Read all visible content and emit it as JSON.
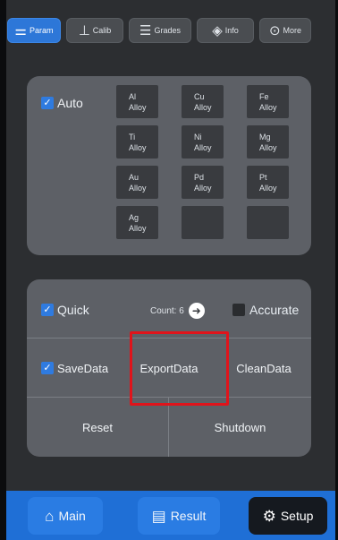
{
  "top_tabs": [
    {
      "label": "Param",
      "icon": "params-sliders-icon",
      "active": true
    },
    {
      "label": "Calib",
      "icon": "calibration-icon",
      "active": false
    },
    {
      "label": "Grades",
      "icon": "grades-database-icon",
      "active": false
    },
    {
      "label": "Info",
      "icon": "info-layers-icon",
      "active": false
    },
    {
      "label": "More",
      "icon": "more-dots-icon",
      "active": false
    }
  ],
  "alloy_panel": {
    "auto_label": "Auto",
    "auto_checked": true,
    "alloys": [
      {
        "element": "Al",
        "suffix": "Alloy"
      },
      {
        "element": "Cu",
        "suffix": "Alloy"
      },
      {
        "element": "Fe",
        "suffix": "Alloy"
      },
      {
        "element": "Ti",
        "suffix": "Alloy"
      },
      {
        "element": "Ni",
        "suffix": "Alloy"
      },
      {
        "element": "Mg",
        "suffix": "Alloy"
      },
      {
        "element": "Au",
        "suffix": "Alloy"
      },
      {
        "element": "Pd",
        "suffix": "Alloy"
      },
      {
        "element": "Pt",
        "suffix": "Alloy"
      },
      {
        "element": "Ag",
        "suffix": "Alloy"
      }
    ]
  },
  "measure_panel": {
    "quick_label": "Quick",
    "quick_checked": true,
    "count_label": "Count: 6",
    "accurate_label": "Accurate",
    "accurate_checked": false,
    "savedata_label": "SaveData",
    "savedata_checked": true,
    "exportdata_label": "ExportData",
    "cleandata_label": "CleanData",
    "reset_label": "Reset",
    "shutdown_label": "Shutdown"
  },
  "bottom_nav": [
    {
      "label": "Main",
      "icon": "home-icon",
      "active": false
    },
    {
      "label": "Result",
      "icon": "result-document-icon",
      "active": false
    },
    {
      "label": "Setup",
      "icon": "gear-icon",
      "active": true
    }
  ],
  "colors": {
    "accent": "#2d77d8",
    "highlight_box": "#e0141b",
    "panel": "#5d6066"
  }
}
